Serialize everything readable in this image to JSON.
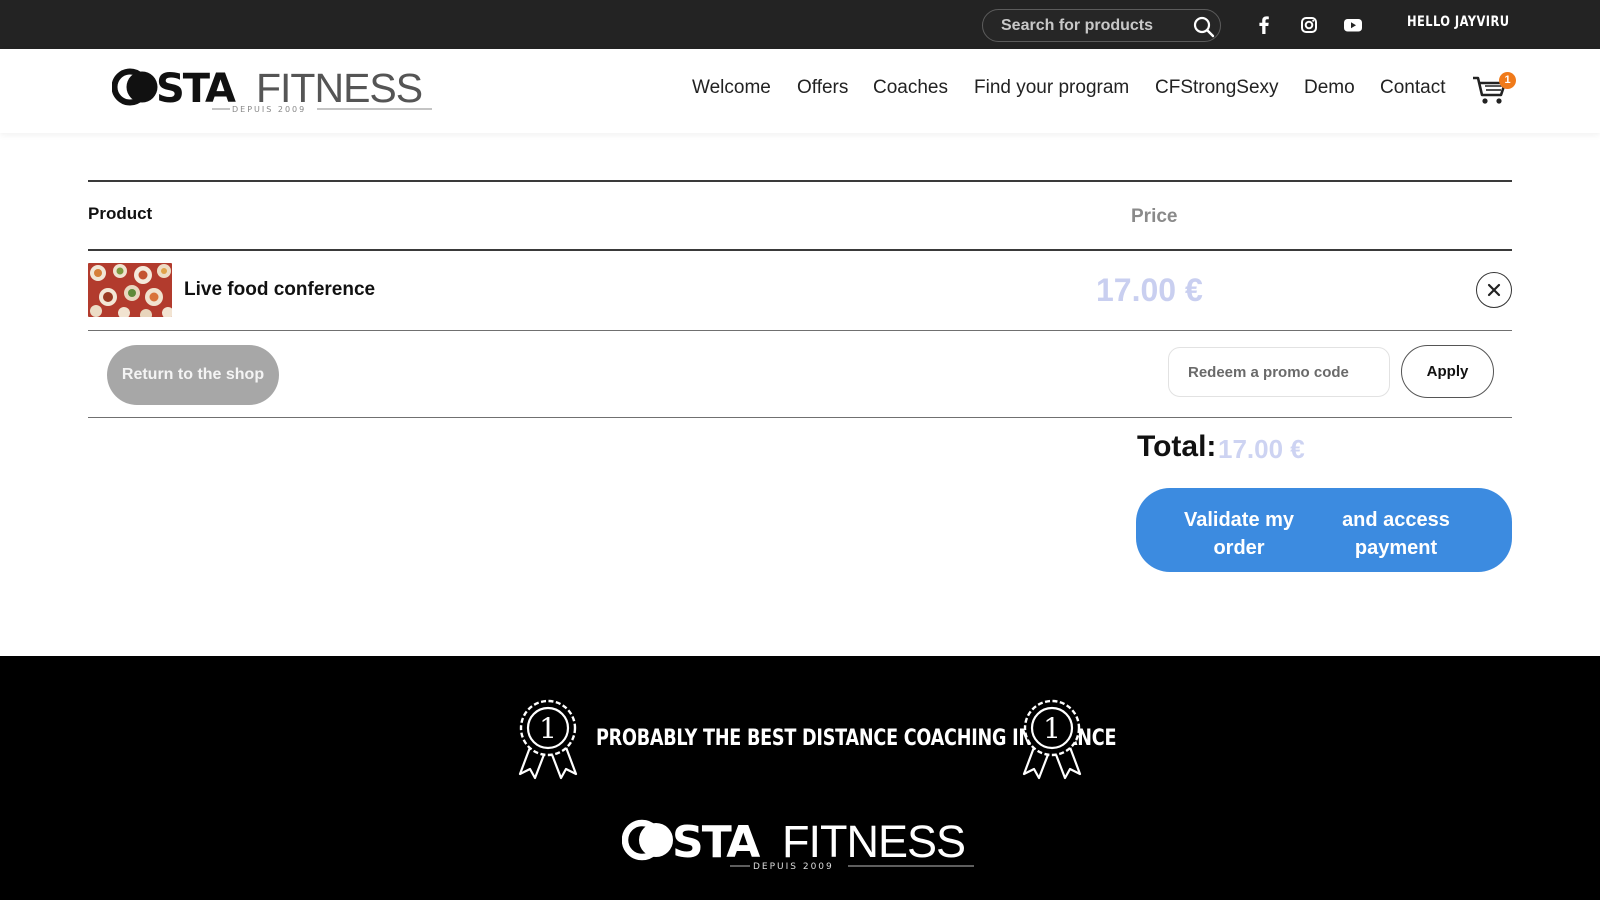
{
  "topbar": {
    "search_placeholder": "Search for products",
    "icons": [
      "search-icon",
      "facebook-icon",
      "instagram-icon",
      "youtube-icon"
    ],
    "greeting": "HELLO JAYVIRU"
  },
  "brand": {
    "logo_primary": "COSTA",
    "logo_secondary": "FITNESS",
    "logo_since": "DEPUIS 2009"
  },
  "nav": {
    "items": [
      "Welcome",
      "Offers",
      "Coaches",
      "Find your program",
      "CFStrongSexy",
      "Demo",
      "Contact"
    ],
    "cart_count": "1"
  },
  "cart": {
    "columns": {
      "product": "Product",
      "price": "Price"
    },
    "items": [
      {
        "name": "Live food conference",
        "price": "17.00 €"
      }
    ],
    "return_label": "Return to the shop",
    "promo_placeholder": "Redeem a promo code",
    "apply_label": "Apply",
    "total_label": "Total:",
    "total_value": "17.00 €",
    "validate_line1": "Validate my order",
    "validate_line2": "and access payment"
  },
  "footer": {
    "tagline": "PROBABLY THE BEST DISTANCE COACHING IN FRANCE",
    "badge_number": "1"
  },
  "colors": {
    "topbar_bg": "#232323",
    "price_color": "#c9cff0",
    "validate_bg": "#3c8be0",
    "return_bg": "#a7a7a7",
    "cart_badge": "#f07a1a"
  }
}
